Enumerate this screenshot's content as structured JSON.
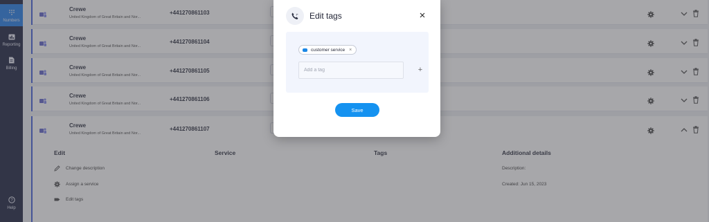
{
  "sidebar": {
    "items": [
      {
        "label": "Numbers",
        "icon": "numbers-icon",
        "active": true
      },
      {
        "label": "Reporting",
        "icon": "reporting-icon",
        "active": false
      },
      {
        "label": "Billing",
        "icon": "billing-icon",
        "active": false
      }
    ],
    "help_label": "Help"
  },
  "rows": [
    {
      "name": "Crewe",
      "country": "United Kingdom of Great Britain and Nor...",
      "number": "+441270861103"
    },
    {
      "name": "Crewe",
      "country": "United Kingdom of Great Britain and Nor...",
      "number": "+441270861104"
    },
    {
      "name": "Crewe",
      "country": "United Kingdom of Great Britain and Nor...",
      "number": "+441270861105"
    },
    {
      "name": "Crewe",
      "country": "United Kingdom of Great Britain and Nor...",
      "number": "+441270861106"
    },
    {
      "name": "Crewe",
      "country": "United Kingdom of Great Britain and Nor...",
      "number": "+441270861107"
    }
  ],
  "expanded": {
    "headers": {
      "edit": "Edit",
      "service": "Service",
      "tags": "Tags",
      "details": "Additional details"
    },
    "actions": {
      "change_description": "Change description",
      "assign_service": "Assign a service",
      "edit_tags": "Edit tags"
    },
    "details": {
      "description": "Description:",
      "created": "Created: Jun 15, 2023"
    }
  },
  "modal": {
    "title": "Edit tags",
    "tags": [
      "customer service"
    ],
    "input_placeholder": "Add a tag",
    "save_label": "Save"
  },
  "colors": {
    "sidebar_bg": "#141a38",
    "active_nav": "#1b79e6",
    "accent": "#3a58d8",
    "save_button": "#1592f0"
  }
}
